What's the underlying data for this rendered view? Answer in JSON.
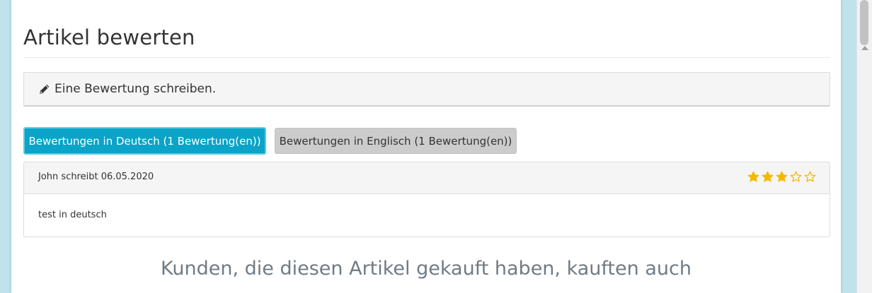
{
  "reviews_section": {
    "title": "Artikel bewerten",
    "write_review_label": "Eine Bewertung schreiben."
  },
  "tabs": [
    {
      "label": "Bewertungen in Deutsch (1 Bewertung(en))",
      "active": true
    },
    {
      "label": "Bewertungen in Englisch (1 Bewertung(en))",
      "active": false
    }
  ],
  "review": {
    "author_line": "John schreibt 06.05.2020",
    "rating": 3,
    "max_rating": 5,
    "text": "test in deutsch"
  },
  "also_bought": {
    "heading": "Kunden, die diesen Artikel gekauft haben, kauften auch"
  },
  "icons": {
    "write": "pencil-icon",
    "rating_full": "star-filled-icon",
    "rating_empty": "star-outline-icon"
  },
  "colors": {
    "active_tab": "#0ba3c8",
    "inactive_tab": "#cccccc",
    "star": "#f5b800",
    "background": "#bfe2ec"
  }
}
